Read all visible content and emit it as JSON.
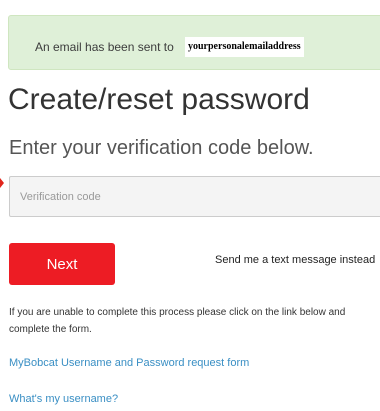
{
  "alert": {
    "message": "An email has been sent to",
    "email": "yourpersonalemailaddress"
  },
  "header": {
    "title": "Create/reset password",
    "subtitle": "Enter your verification code below."
  },
  "form": {
    "code_placeholder": "Verification code",
    "code_value": "",
    "next_label": "Next",
    "text_message_label": "Send me a text message instead"
  },
  "help": {
    "text": "If you are unable to complete this process please click on the link below and complete the form."
  },
  "links": {
    "request_form": "MyBobcat Username and Password request form",
    "whats_username": "What's my username?"
  },
  "colors": {
    "alert_bg": "#dff0d8",
    "button": "#ed1c24",
    "link": "#3a8fc4"
  }
}
